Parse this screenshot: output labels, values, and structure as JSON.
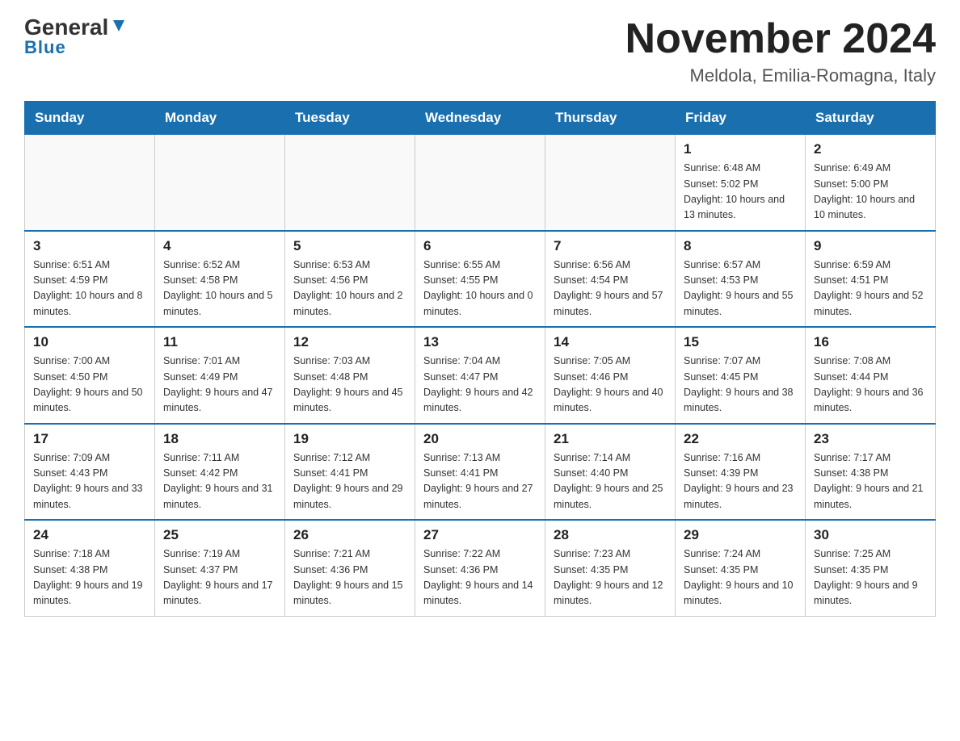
{
  "header": {
    "logo_main": "General",
    "logo_sub": "Blue",
    "month_title": "November 2024",
    "location": "Meldola, Emilia-Romagna, Italy"
  },
  "weekdays": [
    "Sunday",
    "Monday",
    "Tuesday",
    "Wednesday",
    "Thursday",
    "Friday",
    "Saturday"
  ],
  "weeks": [
    [
      {
        "day": "",
        "sunrise": "",
        "sunset": "",
        "daylight": ""
      },
      {
        "day": "",
        "sunrise": "",
        "sunset": "",
        "daylight": ""
      },
      {
        "day": "",
        "sunrise": "",
        "sunset": "",
        "daylight": ""
      },
      {
        "day": "",
        "sunrise": "",
        "sunset": "",
        "daylight": ""
      },
      {
        "day": "",
        "sunrise": "",
        "sunset": "",
        "daylight": ""
      },
      {
        "day": "1",
        "sunrise": "Sunrise: 6:48 AM",
        "sunset": "Sunset: 5:02 PM",
        "daylight": "Daylight: 10 hours and 13 minutes."
      },
      {
        "day": "2",
        "sunrise": "Sunrise: 6:49 AM",
        "sunset": "Sunset: 5:00 PM",
        "daylight": "Daylight: 10 hours and 10 minutes."
      }
    ],
    [
      {
        "day": "3",
        "sunrise": "Sunrise: 6:51 AM",
        "sunset": "Sunset: 4:59 PM",
        "daylight": "Daylight: 10 hours and 8 minutes."
      },
      {
        "day": "4",
        "sunrise": "Sunrise: 6:52 AM",
        "sunset": "Sunset: 4:58 PM",
        "daylight": "Daylight: 10 hours and 5 minutes."
      },
      {
        "day": "5",
        "sunrise": "Sunrise: 6:53 AM",
        "sunset": "Sunset: 4:56 PM",
        "daylight": "Daylight: 10 hours and 2 minutes."
      },
      {
        "day": "6",
        "sunrise": "Sunrise: 6:55 AM",
        "sunset": "Sunset: 4:55 PM",
        "daylight": "Daylight: 10 hours and 0 minutes."
      },
      {
        "day": "7",
        "sunrise": "Sunrise: 6:56 AM",
        "sunset": "Sunset: 4:54 PM",
        "daylight": "Daylight: 9 hours and 57 minutes."
      },
      {
        "day": "8",
        "sunrise": "Sunrise: 6:57 AM",
        "sunset": "Sunset: 4:53 PM",
        "daylight": "Daylight: 9 hours and 55 minutes."
      },
      {
        "day": "9",
        "sunrise": "Sunrise: 6:59 AM",
        "sunset": "Sunset: 4:51 PM",
        "daylight": "Daylight: 9 hours and 52 minutes."
      }
    ],
    [
      {
        "day": "10",
        "sunrise": "Sunrise: 7:00 AM",
        "sunset": "Sunset: 4:50 PM",
        "daylight": "Daylight: 9 hours and 50 minutes."
      },
      {
        "day": "11",
        "sunrise": "Sunrise: 7:01 AM",
        "sunset": "Sunset: 4:49 PM",
        "daylight": "Daylight: 9 hours and 47 minutes."
      },
      {
        "day": "12",
        "sunrise": "Sunrise: 7:03 AM",
        "sunset": "Sunset: 4:48 PM",
        "daylight": "Daylight: 9 hours and 45 minutes."
      },
      {
        "day": "13",
        "sunrise": "Sunrise: 7:04 AM",
        "sunset": "Sunset: 4:47 PM",
        "daylight": "Daylight: 9 hours and 42 minutes."
      },
      {
        "day": "14",
        "sunrise": "Sunrise: 7:05 AM",
        "sunset": "Sunset: 4:46 PM",
        "daylight": "Daylight: 9 hours and 40 minutes."
      },
      {
        "day": "15",
        "sunrise": "Sunrise: 7:07 AM",
        "sunset": "Sunset: 4:45 PM",
        "daylight": "Daylight: 9 hours and 38 minutes."
      },
      {
        "day": "16",
        "sunrise": "Sunrise: 7:08 AM",
        "sunset": "Sunset: 4:44 PM",
        "daylight": "Daylight: 9 hours and 36 minutes."
      }
    ],
    [
      {
        "day": "17",
        "sunrise": "Sunrise: 7:09 AM",
        "sunset": "Sunset: 4:43 PM",
        "daylight": "Daylight: 9 hours and 33 minutes."
      },
      {
        "day": "18",
        "sunrise": "Sunrise: 7:11 AM",
        "sunset": "Sunset: 4:42 PM",
        "daylight": "Daylight: 9 hours and 31 minutes."
      },
      {
        "day": "19",
        "sunrise": "Sunrise: 7:12 AM",
        "sunset": "Sunset: 4:41 PM",
        "daylight": "Daylight: 9 hours and 29 minutes."
      },
      {
        "day": "20",
        "sunrise": "Sunrise: 7:13 AM",
        "sunset": "Sunset: 4:41 PM",
        "daylight": "Daylight: 9 hours and 27 minutes."
      },
      {
        "day": "21",
        "sunrise": "Sunrise: 7:14 AM",
        "sunset": "Sunset: 4:40 PM",
        "daylight": "Daylight: 9 hours and 25 minutes."
      },
      {
        "day": "22",
        "sunrise": "Sunrise: 7:16 AM",
        "sunset": "Sunset: 4:39 PM",
        "daylight": "Daylight: 9 hours and 23 minutes."
      },
      {
        "day": "23",
        "sunrise": "Sunrise: 7:17 AM",
        "sunset": "Sunset: 4:38 PM",
        "daylight": "Daylight: 9 hours and 21 minutes."
      }
    ],
    [
      {
        "day": "24",
        "sunrise": "Sunrise: 7:18 AM",
        "sunset": "Sunset: 4:38 PM",
        "daylight": "Daylight: 9 hours and 19 minutes."
      },
      {
        "day": "25",
        "sunrise": "Sunrise: 7:19 AM",
        "sunset": "Sunset: 4:37 PM",
        "daylight": "Daylight: 9 hours and 17 minutes."
      },
      {
        "day": "26",
        "sunrise": "Sunrise: 7:21 AM",
        "sunset": "Sunset: 4:36 PM",
        "daylight": "Daylight: 9 hours and 15 minutes."
      },
      {
        "day": "27",
        "sunrise": "Sunrise: 7:22 AM",
        "sunset": "Sunset: 4:36 PM",
        "daylight": "Daylight: 9 hours and 14 minutes."
      },
      {
        "day": "28",
        "sunrise": "Sunrise: 7:23 AM",
        "sunset": "Sunset: 4:35 PM",
        "daylight": "Daylight: 9 hours and 12 minutes."
      },
      {
        "day": "29",
        "sunrise": "Sunrise: 7:24 AM",
        "sunset": "Sunset: 4:35 PM",
        "daylight": "Daylight: 9 hours and 10 minutes."
      },
      {
        "day": "30",
        "sunrise": "Sunrise: 7:25 AM",
        "sunset": "Sunset: 4:35 PM",
        "daylight": "Daylight: 9 hours and 9 minutes."
      }
    ]
  ]
}
